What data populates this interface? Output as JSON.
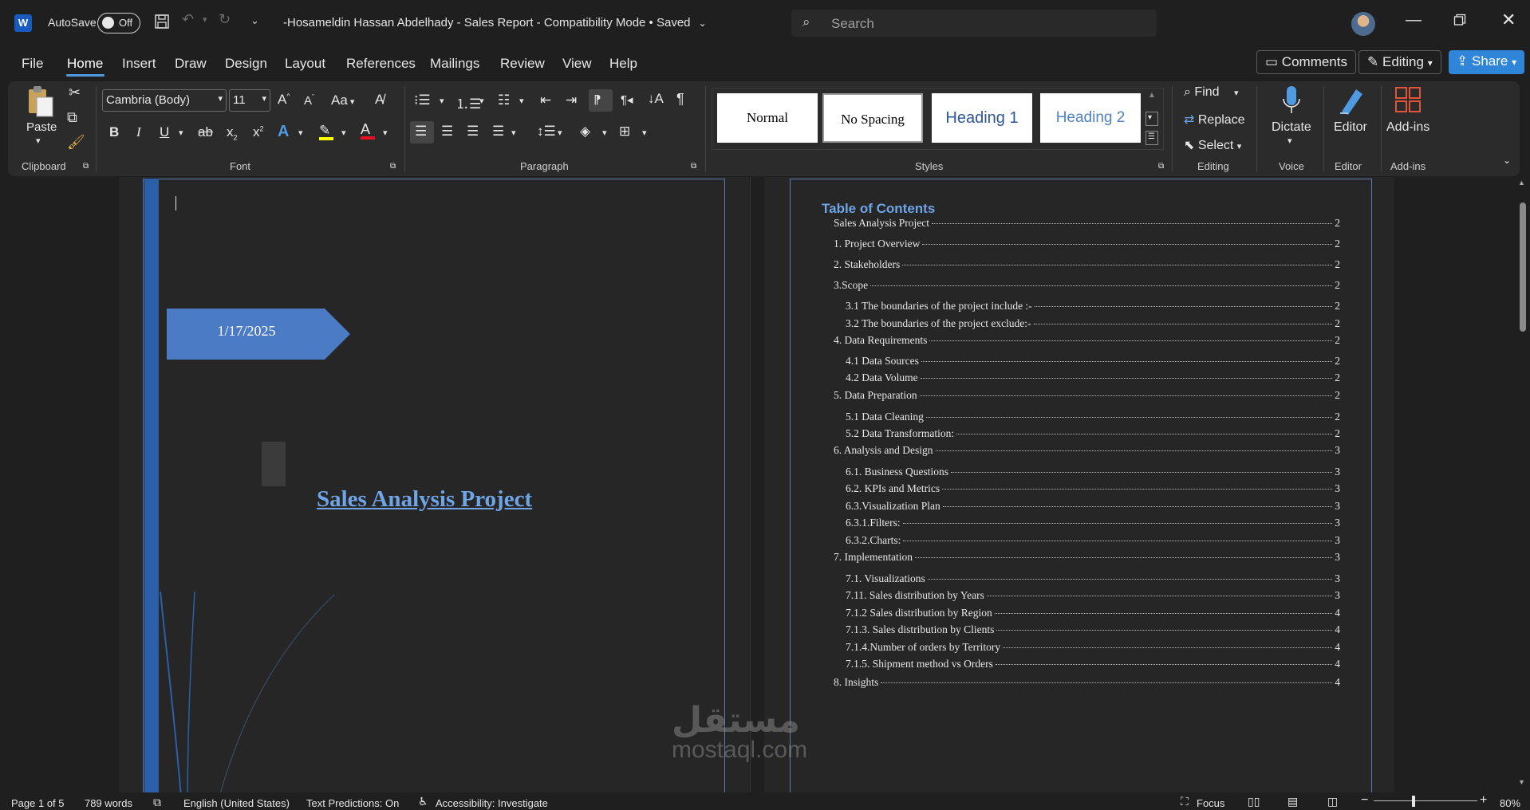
{
  "titlebar": {
    "app_icon_letter": "W",
    "autosave_label": "AutoSave",
    "autosave_state": "Off",
    "document_title": "-Hosameldin Hassan Abdelhady - Sales Report  -  Compatibility Mode • Saved",
    "search_placeholder": "Search"
  },
  "menu": {
    "tabs": [
      "File",
      "Home",
      "Insert",
      "Draw",
      "Design",
      "Layout",
      "References",
      "Mailings",
      "Review",
      "View",
      "Help"
    ],
    "active_tab": "Home",
    "comments_label": "Comments",
    "editing_label": "Editing",
    "share_label": "Share"
  },
  "ribbon": {
    "clipboard": {
      "paste_label": "Paste",
      "group_label": "Clipboard"
    },
    "font": {
      "font_name": "Cambria (Body)",
      "font_size": "11",
      "group_label": "Font",
      "change_case": "Aa"
    },
    "paragraph": {
      "group_label": "Paragraph"
    },
    "styles": {
      "items": [
        "Normal",
        "No Spacing",
        "Heading 1",
        "Heading 2"
      ],
      "group_label": "Styles"
    },
    "editing": {
      "find": "Find",
      "replace": "Replace",
      "select": "Select",
      "group_label": "Editing"
    },
    "voice": {
      "dictate": "Dictate",
      "group_label": "Voice"
    },
    "editor": {
      "editor": "Editor",
      "group_label": "Editor"
    },
    "addins": {
      "addins": "Add-ins",
      "group_label": "Add-ins"
    }
  },
  "document": {
    "cover": {
      "date": "1/17/2025",
      "title": "Sales Analysis Project"
    },
    "toc": {
      "title": "Table of Contents",
      "entries": [
        {
          "text": "Sales Analysis Project",
          "page": "2",
          "level": 0
        },
        {
          "text": "1. Project Overview",
          "page": "2",
          "level": 0
        },
        {
          "text": "2. Stakeholders",
          "page": "2",
          "level": 0
        },
        {
          "text": "3.Scope",
          "page": "2",
          "level": 0
        },
        {
          "text": "3.1 The boundaries of the project include :-",
          "page": "2",
          "level": 1
        },
        {
          "text": "3.2 The boundaries of the project exclude:-",
          "page": "2",
          "level": 1
        },
        {
          "text": "4. Data Requirements",
          "page": "2",
          "level": 0
        },
        {
          "text": "4.1 Data Sources",
          "page": "2",
          "level": 1
        },
        {
          "text": "4.2 Data Volume",
          "page": "2",
          "level": 1
        },
        {
          "text": "5. Data Preparation",
          "page": "2",
          "level": 0
        },
        {
          "text": "5.1 Data Cleaning",
          "page": "2",
          "level": 1
        },
        {
          "text": "5.2 Data Transformation:",
          "page": "2",
          "level": 1
        },
        {
          "text": "6. Analysis and Design",
          "page": "3",
          "level": 0
        },
        {
          "text": "6.1. Business Questions",
          "page": "3",
          "level": 1
        },
        {
          "text": "6.2. KPIs and Metrics",
          "page": "3",
          "level": 1
        },
        {
          "text": "6.3.Visualization Plan",
          "page": "3",
          "level": 1
        },
        {
          "text": "6.3.1.Filters:",
          "page": "3",
          "level": 1
        },
        {
          "text": "6.3.2.Charts:",
          "page": "3",
          "level": 1
        },
        {
          "text": "7. Implementation",
          "page": "3",
          "level": 0
        },
        {
          "text": "7.1. Visualizations",
          "page": "3",
          "level": 1
        },
        {
          "text": "7.11. Sales distribution by Years",
          "page": "3",
          "level": 1
        },
        {
          "text": "7.1.2 Sales distribution by Region",
          "page": "4",
          "level": 1
        },
        {
          "text": "7.1.3. Sales distribution by Clients",
          "page": "4",
          "level": 1
        },
        {
          "text": "7.1.4.Number of orders by Territory",
          "page": "4",
          "level": 1
        },
        {
          "text": "7.1.5. Shipment method vs Orders",
          "page": "4",
          "level": 1
        },
        {
          "text": "8. Insights",
          "page": "4",
          "level": 0
        }
      ]
    }
  },
  "statusbar": {
    "page": "Page 1 of 5",
    "words": "789 words",
    "language": "English (United States)",
    "text_predictions": "Text Predictions: On",
    "accessibility": "Accessibility: Investigate",
    "focus": "Focus",
    "zoom": "80%"
  },
  "watermark": {
    "arabic": "مستقل",
    "latin": "mostaql.com"
  },
  "colors": {
    "accent": "#4f9ae0",
    "share": "#2f86d9",
    "cover_bar": "#2b5fa8",
    "date_banner": "#4a7bc4",
    "toc_title": "#6fa4e6"
  }
}
